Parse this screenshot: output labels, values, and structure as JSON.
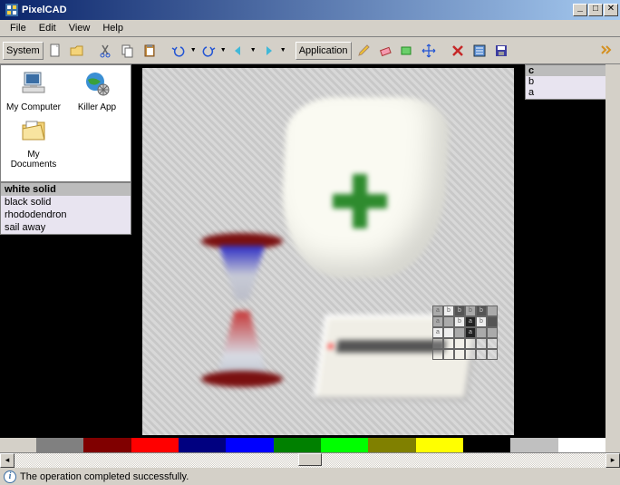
{
  "titlebar": {
    "title": "PixelCAD"
  },
  "menu": {
    "file": "File",
    "edit": "Edit",
    "view": "View",
    "help": "Help"
  },
  "toolbar": {
    "system_label": "System",
    "application_label": "Application"
  },
  "desktop": {
    "items": [
      {
        "label": "My Computer",
        "icon": "computer"
      },
      {
        "label": "Killer App",
        "icon": "earth-gear"
      },
      {
        "label": "My Documents",
        "icon": "folder-docs"
      }
    ]
  },
  "layer_list": {
    "items": [
      "white solid",
      "black solid",
      "rhododendron",
      "sail away"
    ],
    "selected_index": 0
  },
  "mini_list": {
    "items": [
      {
        "label": "c",
        "glyph": ""
      },
      {
        "label": "b",
        "glyph": "↔"
      },
      {
        "label": "a",
        "glyph": "◧"
      }
    ],
    "selected_index": 0
  },
  "palette": {
    "colors": [
      "#808080",
      "#800000",
      "#ff0000",
      "#000080",
      "#0000ff",
      "#008000",
      "#00ff00",
      "#808000",
      "#ffff00",
      "#000000",
      "#c0c0c0",
      "#ffffff"
    ]
  },
  "status": {
    "message": "The operation completed successfully."
  }
}
